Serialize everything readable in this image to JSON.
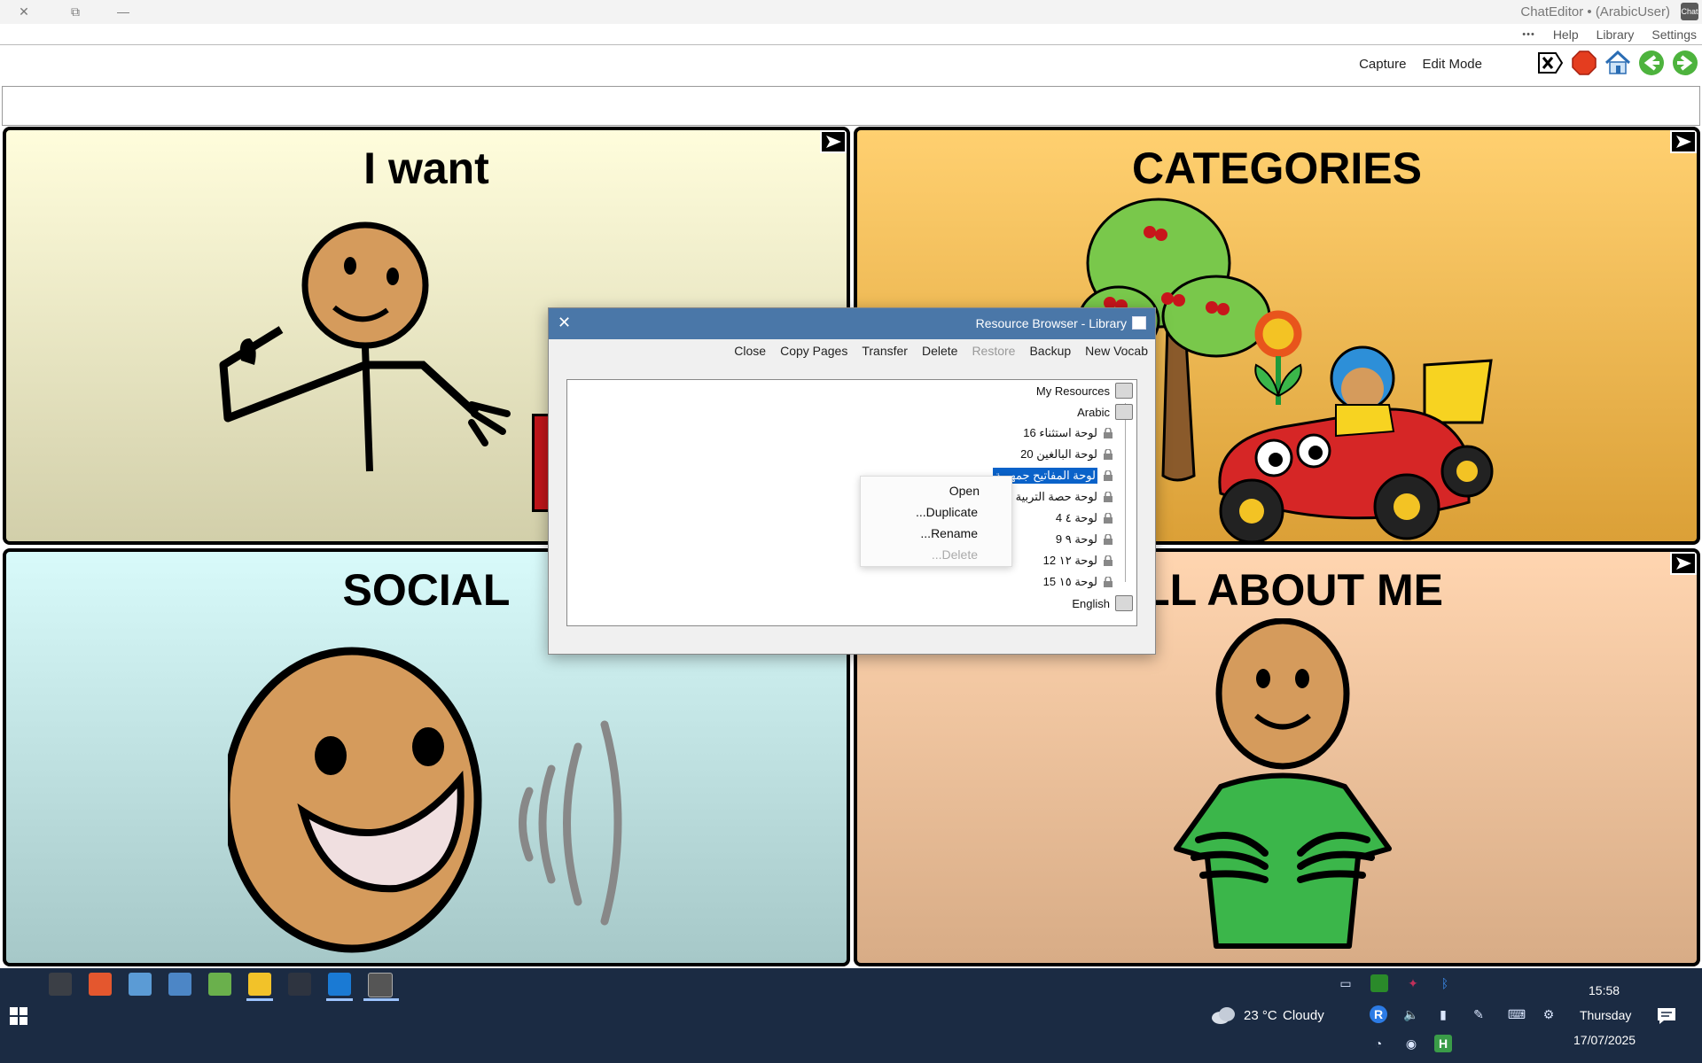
{
  "window": {
    "title": "ChatEditor • (ArabicUser)",
    "app_icon_text": "Chat",
    "controls": [
      "close-icon",
      "restore-icon",
      "minimize-icon"
    ]
  },
  "menu": {
    "more": "•••",
    "help": "Help",
    "library": "Library",
    "settings": "Settings"
  },
  "toolbar": {
    "capture": "Capture",
    "edit_mode": "Edit Mode",
    "icons": [
      "clear-x-icon",
      "stop-icon",
      "home-icon",
      "back-arrow-icon",
      "forward-arrow-icon"
    ]
  },
  "message_bar": {
    "value": ""
  },
  "tiles": [
    {
      "label": "I want",
      "color": "#fffddc"
    },
    {
      "label": "CATEGORIES",
      "color": "#ffd070"
    },
    {
      "label": "SOCIAL",
      "color": "#d8fafa"
    },
    {
      "label": "ALL ABOUT ME",
      "color": "#ffd5b0"
    }
  ],
  "dialog": {
    "title": "Resource Browser - Library",
    "actions": {
      "close": "Close",
      "copy_pages": "Copy Pages",
      "transfer": "Transfer",
      "delete": "Delete",
      "restore": "Restore",
      "backup": "Backup",
      "new_vocab": "New Vocab"
    },
    "tree": {
      "root": "My Resources",
      "arabic": "Arabic",
      "items": [
        "لوحة استثناء 16",
        "لوحة البالغين 20",
        "لوحة المفاتيح جمهرية",
        "لوحة حصة التربية",
        "لوحة ٤ 4",
        "لوحة ٩ 9",
        "لوحة ١٢ 12",
        "لوحة ١٥ 15"
      ],
      "english": "English"
    }
  },
  "context_menu": {
    "open": "Open",
    "duplicate": "...Duplicate",
    "rename": "...Rename",
    "delete": "...Delete"
  },
  "taskbar": {
    "weather_temp": "23 °C",
    "weather_text": "Cloudy",
    "time": "15:58",
    "day": "Thursday",
    "date": "17/07/2025"
  }
}
